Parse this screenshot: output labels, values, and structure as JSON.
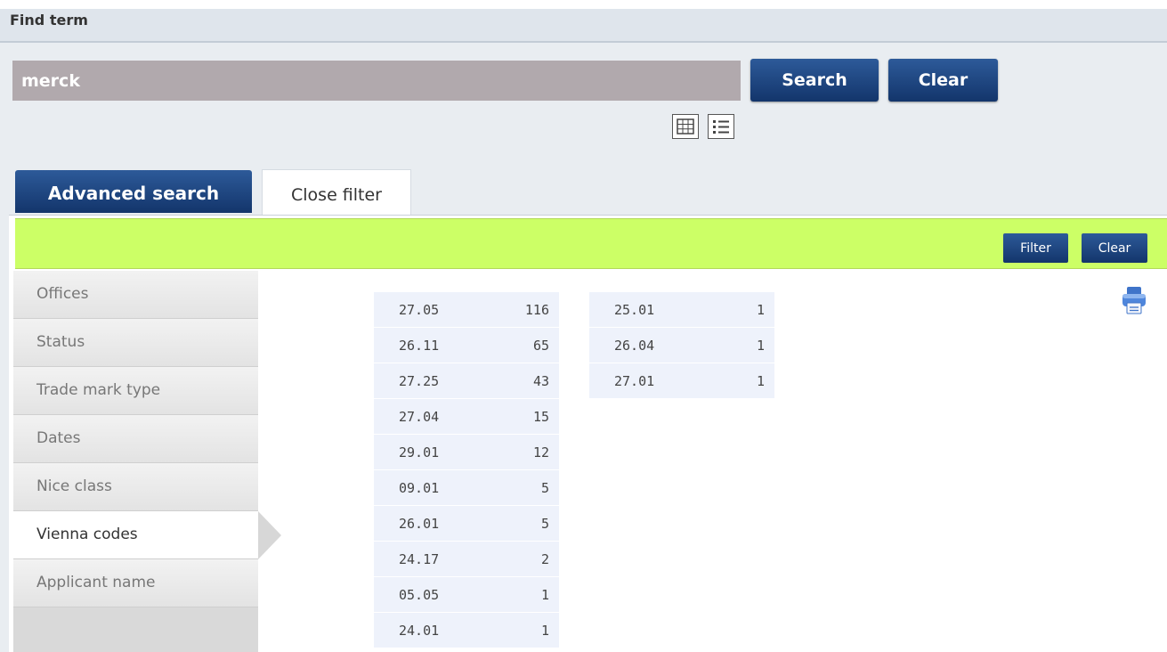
{
  "header": {
    "title": "Find term"
  },
  "search": {
    "value": "merck",
    "search_label": "Search",
    "clear_label": "Clear"
  },
  "view_icons": {
    "grid": "grid-view-icon",
    "list": "list-view-icon"
  },
  "tabs": {
    "advanced_label": "Advanced search",
    "close_filter_label": "Close filter"
  },
  "filter_bar": {
    "filter_label": "Filter",
    "clear_label": "Clear"
  },
  "menu": {
    "items": [
      {
        "label": "Offices",
        "active": false
      },
      {
        "label": "Status",
        "active": false
      },
      {
        "label": "Trade mark type",
        "active": false
      },
      {
        "label": "Dates",
        "active": false
      },
      {
        "label": "Nice class",
        "active": false
      },
      {
        "label": "Vienna codes",
        "active": true
      },
      {
        "label": "Applicant name",
        "active": false
      }
    ]
  },
  "vienna_codes": {
    "column1": [
      {
        "code": "27.05",
        "count": "116"
      },
      {
        "code": "26.11",
        "count": "65"
      },
      {
        "code": "27.25",
        "count": "43"
      },
      {
        "code": "27.04",
        "count": "15"
      },
      {
        "code": "29.01",
        "count": "12"
      },
      {
        "code": "09.01",
        "count": "5"
      },
      {
        "code": "26.01",
        "count": "5"
      },
      {
        "code": "24.17",
        "count": "2"
      },
      {
        "code": "05.05",
        "count": "1"
      },
      {
        "code": "24.01",
        "count": "1"
      }
    ],
    "column2": [
      {
        "code": "25.01",
        "count": "1"
      },
      {
        "code": "26.04",
        "count": "1"
      },
      {
        "code": "27.01",
        "count": "1"
      }
    ]
  },
  "colors": {
    "accent": "#1d4480",
    "filter_bar": "#ccff66",
    "search_field": "#b1a9ad"
  }
}
